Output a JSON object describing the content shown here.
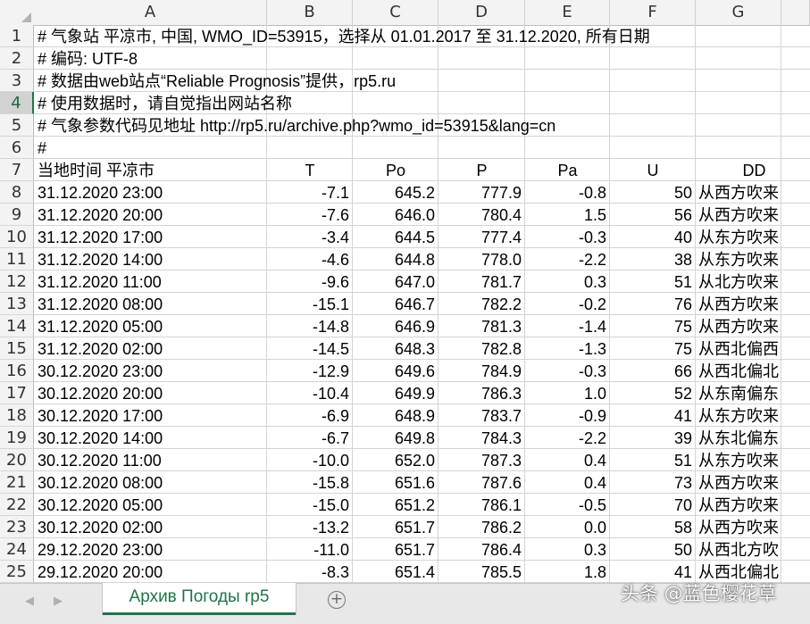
{
  "columns": [
    "A",
    "B",
    "C",
    "D",
    "E",
    "F",
    "G"
  ],
  "rows": [
    {
      "n": "1",
      "a": "# 气象站 平凉市, 中国, WMO_ID=53915，选择从 01.01.2017 至 31.12.2020, 所有日期",
      "b": "",
      "c": "",
      "d": "",
      "e": "",
      "f": "",
      "g": ""
    },
    {
      "n": "2",
      "a": "# 编码: UTF-8",
      "b": "",
      "c": "",
      "d": "",
      "e": "",
      "f": "",
      "g": ""
    },
    {
      "n": "3",
      "a": "# 数据由web站点“Reliable Prognosis”提供，rp5.ru",
      "b": "",
      "c": "",
      "d": "",
      "e": "",
      "f": "",
      "g": ""
    },
    {
      "n": "4",
      "a": "# 使用数据时，请自觉指出网站名称",
      "b": "",
      "c": "",
      "d": "",
      "e": "",
      "f": "",
      "g": ""
    },
    {
      "n": "5",
      "a": "# 气象参数代码见地址 http://rp5.ru/archive.php?wmo_id=53915&lang=cn",
      "b": "",
      "c": "",
      "d": "",
      "e": "",
      "f": "",
      "g": ""
    },
    {
      "n": "6",
      "a": "#",
      "b": "",
      "c": "",
      "d": "",
      "e": "",
      "f": "",
      "g": ""
    },
    {
      "n": "7",
      "a": "当地时间 平凉市",
      "b": "T",
      "c": "Po",
      "d": "P",
      "e": "Pa",
      "f": "U",
      "g": "DD"
    },
    {
      "n": "8",
      "a": "31.12.2020 23:00",
      "b": "-7.1",
      "c": "645.2",
      "d": "777.9",
      "e": "-0.8",
      "f": "50",
      "g": "从西方吹来"
    },
    {
      "n": "9",
      "a": "31.12.2020 20:00",
      "b": "-7.6",
      "c": "646.0",
      "d": "780.4",
      "e": "1.5",
      "f": "56",
      "g": "从西方吹来"
    },
    {
      "n": "10",
      "a": "31.12.2020 17:00",
      "b": "-3.4",
      "c": "644.5",
      "d": "777.4",
      "e": "-0.3",
      "f": "40",
      "g": "从东方吹来"
    },
    {
      "n": "11",
      "a": "31.12.2020 14:00",
      "b": "-4.6",
      "c": "644.8",
      "d": "778.0",
      "e": "-2.2",
      "f": "38",
      "g": "从东方吹来"
    },
    {
      "n": "12",
      "a": "31.12.2020 11:00",
      "b": "-9.6",
      "c": "647.0",
      "d": "781.7",
      "e": "0.3",
      "f": "51",
      "g": "从北方吹来"
    },
    {
      "n": "13",
      "a": "31.12.2020 08:00",
      "b": "-15.1",
      "c": "646.7",
      "d": "782.2",
      "e": "-0.2",
      "f": "76",
      "g": "从西方吹来"
    },
    {
      "n": "14",
      "a": "31.12.2020 05:00",
      "b": "-14.8",
      "c": "646.9",
      "d": "781.3",
      "e": "-1.4",
      "f": "75",
      "g": "从西方吹来"
    },
    {
      "n": "15",
      "a": "31.12.2020 02:00",
      "b": "-14.5",
      "c": "648.3",
      "d": "782.8",
      "e": "-1.3",
      "f": "75",
      "g": "从西北偏西"
    },
    {
      "n": "16",
      "a": "30.12.2020 23:00",
      "b": "-12.9",
      "c": "649.6",
      "d": "784.9",
      "e": "-0.3",
      "f": "66",
      "g": "从西北偏北"
    },
    {
      "n": "17",
      "a": "30.12.2020 20:00",
      "b": "-10.4",
      "c": "649.9",
      "d": "786.3",
      "e": "1.0",
      "f": "52",
      "g": "从东南偏东"
    },
    {
      "n": "18",
      "a": "30.12.2020 17:00",
      "b": "-6.9",
      "c": "648.9",
      "d": "783.7",
      "e": "-0.9",
      "f": "41",
      "g": "从东方吹来"
    },
    {
      "n": "19",
      "a": "30.12.2020 14:00",
      "b": "-6.7",
      "c": "649.8",
      "d": "784.3",
      "e": "-2.2",
      "f": "39",
      "g": "从东北偏东"
    },
    {
      "n": "20",
      "a": "30.12.2020 11:00",
      "b": "-10.0",
      "c": "652.0",
      "d": "787.3",
      "e": "0.4",
      "f": "51",
      "g": "从东方吹来"
    },
    {
      "n": "21",
      "a": "30.12.2020 08:00",
      "b": "-15.8",
      "c": "651.6",
      "d": "787.6",
      "e": "0.4",
      "f": "73",
      "g": "从西方吹来"
    },
    {
      "n": "22",
      "a": "30.12.2020 05:00",
      "b": "-15.0",
      "c": "651.2",
      "d": "786.1",
      "e": "-0.5",
      "f": "70",
      "g": "从西方吹来"
    },
    {
      "n": "23",
      "a": "30.12.2020 02:00",
      "b": "-13.2",
      "c": "651.7",
      "d": "786.2",
      "e": "0.0",
      "f": "58",
      "g": "从西方吹来"
    },
    {
      "n": "24",
      "a": "29.12.2020 23:00",
      "b": "-11.0",
      "c": "651.7",
      "d": "786.4",
      "e": "0.3",
      "f": "50",
      "g": "从西北方吹"
    },
    {
      "n": "25",
      "a": "29.12.2020 20:00",
      "b": "-8.3",
      "c": "651.4",
      "d": "785.5",
      "e": "1.8",
      "f": "41",
      "g": "从西北偏北"
    }
  ],
  "selected_row": "4",
  "tabs": {
    "prev_icon": "◀",
    "next_icon": "▶",
    "sheet_name": "Архив Погоды rp5",
    "add_icon": "+"
  },
  "watermark": "头条 @蓝色樱花草",
  "colors": {
    "accent": "#217346",
    "header_bg": "#f3f3f3",
    "gridline": "#d4d4d4"
  }
}
